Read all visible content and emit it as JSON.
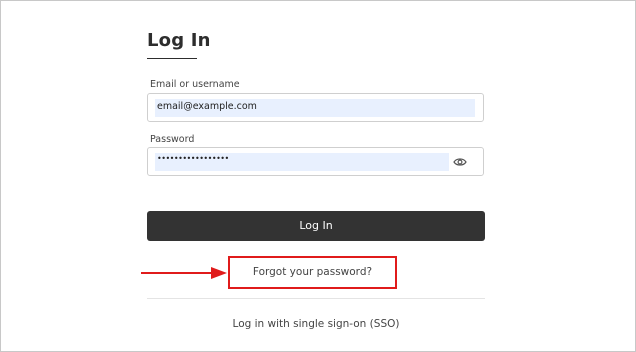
{
  "page": {
    "title": "Log In"
  },
  "form": {
    "email_label": "Email or username",
    "email_value": "email@example.com",
    "password_label": "Password",
    "password_value": "•••••••••••••••••",
    "password_toggle_icon": "eye-icon",
    "login_button_label": "Log In"
  },
  "links": {
    "forgot_password": "Forgot your password?",
    "sso": "Log in with single sign-on (SSO)"
  },
  "annotations": {
    "highlight_color": "#e01b1b",
    "arrow_icon": "arrow-right-icon"
  },
  "colors": {
    "button_bg": "#333333",
    "autofill_bg": "#e8f0fe"
  }
}
